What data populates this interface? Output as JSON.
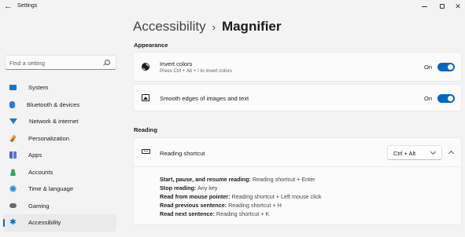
{
  "window": {
    "title": "Settings",
    "back_glyph": "←",
    "close_glyph": "✕"
  },
  "search": {
    "placeholder": "Find a setting"
  },
  "sidebar": {
    "items": [
      {
        "label": "System",
        "icon": "system-icon"
      },
      {
        "label": "Bluetooth & devices",
        "icon": "bluetooth-icon"
      },
      {
        "label": "Network & internet",
        "icon": "network-icon"
      },
      {
        "label": "Personalization",
        "icon": "brush-icon"
      },
      {
        "label": "Apps",
        "icon": "apps-icon"
      },
      {
        "label": "Accounts",
        "icon": "person-icon"
      },
      {
        "label": "Time & language",
        "icon": "globe-clock-icon"
      },
      {
        "label": "Gaming",
        "icon": "controller-icon"
      },
      {
        "label": "Accessibility",
        "icon": "accessibility-icon",
        "active": true
      }
    ]
  },
  "breadcrumb": {
    "parent": "Accessibility",
    "separator": "›",
    "current": "Magnifier"
  },
  "appearance": {
    "title": "Appearance",
    "invert_colors": {
      "title": "Invert colors",
      "subtitle": "Press Ctrl + Alt + I to invert colors",
      "state": "On",
      "enabled": true
    },
    "smooth_edges": {
      "title": "Smooth edges of images and text",
      "state": "On",
      "enabled": true
    }
  },
  "reading": {
    "title": "Reading",
    "shortcut": {
      "title": "Reading shortcut",
      "selected": "Ctrl + Alt",
      "expanded": true
    },
    "lines": [
      {
        "label": "Start, pause, and resume reading:",
        "value": "Reading shortcut + Enter"
      },
      {
        "label": "Stop reading:",
        "value": "Any key"
      },
      {
        "label": "Read from mouse pointer:",
        "value": "Reading shortcut + Left mouse click"
      },
      {
        "label": "Read previous sentence:",
        "value": "Reading shortcut + H"
      },
      {
        "label": "Read next sentence:",
        "value": "Reading shortcut + K"
      }
    ]
  },
  "colors": {
    "accent": "#0067c0",
    "background": "#f3f3f3",
    "card": "#fbfbfb"
  }
}
